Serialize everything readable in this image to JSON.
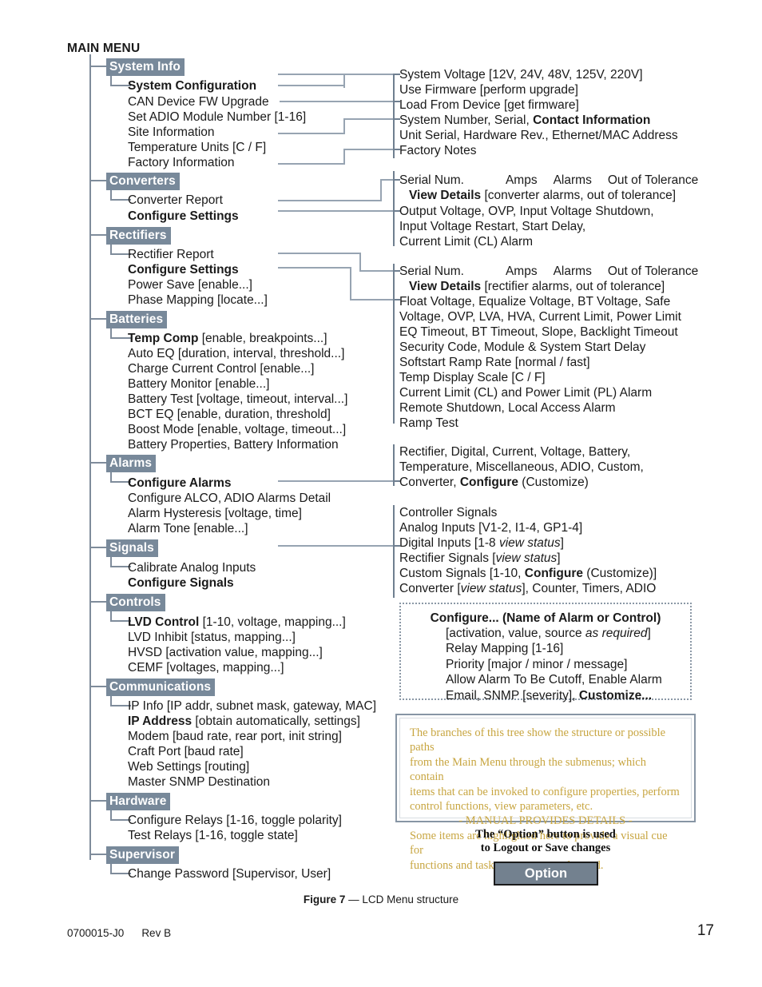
{
  "page": {
    "title": "MAIN MENU",
    "figure_caption_strong": "Figure 7",
    "figure_caption_dash": "—",
    "figure_caption_text": "LCD Menu structure",
    "footer_doc": "0700015-J0",
    "footer_rev": "Rev B",
    "page_number": "17",
    "accent_badge_color": "#78899a",
    "accent_line_color": "#97a4b2",
    "note_text_color": "#c8a642",
    "option_button_color": "#73818f"
  },
  "menu": [
    {
      "key": "system-info",
      "badge": "System Info",
      "items": [
        {
          "label": "System Configuration",
          "bold": true
        },
        {
          "label": "CAN Device FW Upgrade",
          "bold": false
        },
        {
          "label": "Set ADIO Module Number [1-16]",
          "bold": false
        },
        {
          "label": "Site Information",
          "bold": false
        },
        {
          "label": "Temperature Units [C / F]",
          "bold": false
        },
        {
          "label": "Factory Information",
          "bold": false
        }
      ]
    },
    {
      "key": "converters",
      "badge": "Converters",
      "items": [
        {
          "label": "Converter Report",
          "bold": false
        },
        {
          "label": "Configure Settings",
          "bold": true
        }
      ]
    },
    {
      "key": "rectifiers",
      "badge": "Rectifiers",
      "items": [
        {
          "label": "Rectifier Report",
          "bold": false
        },
        {
          "label": "Configure Settings",
          "bold": true
        },
        {
          "label": "Power Save [enable...]",
          "bold": false
        },
        {
          "label": "Phase Mapping [locate...]",
          "bold": false
        }
      ]
    },
    {
      "key": "batteries",
      "badge": "Batteries",
      "items": [
        {
          "label": "Temp Comp [enable, breakpoints...]",
          "bold": false,
          "bold_prefix": "Temp Comp"
        },
        {
          "label": "Auto EQ [duration, interval, threshold...]",
          "bold": false
        },
        {
          "label": "Charge Current Control [enable...]",
          "bold": false
        },
        {
          "label": "Battery Monitor [enable...]",
          "bold": false
        },
        {
          "label": "Battery Test [voltage, timeout, interval...]",
          "bold": false
        },
        {
          "label": "BCT EQ [enable, duration, threshold]",
          "bold": false
        },
        {
          "label": "Boost Mode [enable, voltage, timeout...]",
          "bold": false
        },
        {
          "label": "Battery Properties, Battery Information",
          "bold": false
        }
      ]
    },
    {
      "key": "alarms",
      "badge": "Alarms",
      "items": [
        {
          "label": "Configure Alarms",
          "bold": true
        },
        {
          "label": "Configure ALCO, ADIO Alarms Detail",
          "bold": false
        },
        {
          "label": "Alarm Hysteresis [voltage, time]",
          "bold": false
        },
        {
          "label": "Alarm Tone [enable...]",
          "bold": false
        }
      ]
    },
    {
      "key": "signals",
      "badge": "Signals",
      "items": [
        {
          "label": "Calibrate Analog Inputs",
          "bold": false
        },
        {
          "label": "Configure Signals",
          "bold": true
        }
      ]
    },
    {
      "key": "controls",
      "badge": "Controls",
      "items": [
        {
          "label": "LVD Control [1-10, voltage, mapping...]",
          "bold": false,
          "bold_prefix": "LVD Control"
        },
        {
          "label": "LVD Inhibit [status, mapping...]",
          "bold": false
        },
        {
          "label": "HVSD [activation value, mapping...]",
          "bold": false
        },
        {
          "label": "CEMF [voltages, mapping...]",
          "bold": false
        }
      ]
    },
    {
      "key": "communications",
      "badge": "Communications",
      "items": [
        {
          "label": "IP Info [IP addr, subnet mask, gateway, MAC]",
          "bold": false
        },
        {
          "label": "IP Address [obtain automatically, settings]",
          "bold": false,
          "bold_prefix": "IP Address"
        },
        {
          "label": "Modem [baud rate, rear port, init string]",
          "bold": false
        },
        {
          "label": "Craft Port [baud rate]",
          "bold": false
        },
        {
          "label": "Web Settings [routing]",
          "bold": false
        },
        {
          "label": "Master SNMP Destination",
          "bold": false
        }
      ]
    },
    {
      "key": "hardware",
      "badge": "Hardware",
      "items": [
        {
          "label": "Configure Relays [1-16, toggle polarity]",
          "bold": false
        },
        {
          "label": "Test Relays [1-16, toggle state]",
          "bold": false
        }
      ]
    },
    {
      "key": "supervisor",
      "badge": "Supervisor",
      "items": [
        {
          "label": "Change Password [Supervisor, User]",
          "bold": false
        }
      ]
    }
  ],
  "details": {
    "system_info": [
      "System Voltage [12V, 24V, 48V, 125V, 220V]",
      "Use Firmware [perform upgrade]",
      "Load From Device [get firmware]",
      "System Number, Serial, Contact Information",
      "Unit Serial, Hardware Rev., Ethernet/MAC Address",
      "Factory Notes"
    ],
    "converters": [
      "Serial Num.         Amps    Alarms    Out of Tolerance",
      "View Details [converter alarms, out of tolerance]",
      "Output Voltage, OVP, Input Voltage Shutdown,",
      "Input Voltage Restart, Start Delay,",
      "Current Limit (CL) Alarm"
    ],
    "rectifiers": [
      "Serial Num.         Amps    Alarms    Out of Tolerance",
      "View Details [rectifier alarms, out of tolerance]",
      "Float Voltage, Equalize Voltage, BT Voltage, Safe",
      "Voltage, OVP, LVA, HVA, Current Limit, Power Limit",
      "EQ Timeout, BT Timeout, Slope, Backlight Timeout",
      "Security Code, Module & System Start Delay",
      "Softstart Ramp Rate [normal / fast]",
      "Temp Display Scale [C / F]",
      "Current Limit (CL) and Power Limit (PL) Alarm",
      "Remote Shutdown, Local Access Alarm",
      "Ramp Test"
    ],
    "alarms": [
      "Rectifier, Digital, Current, Voltage, Battery,",
      "Temperature, Miscellaneous, ADIO, Custom,",
      "Converter, Configure (Customize)"
    ],
    "signals": [
      "Controller Signals",
      "Analog Inputs [V1-2, I1-4, GP1-4]",
      "Digital Inputs [1-8 view status]",
      "Rectifier Signals [view status]",
      "Custom Signals [1-10, Configure (Customize)]",
      "Converter [view status], Counter, Timers, ADIO"
    ]
  },
  "configure_box": {
    "title": "Configure... (Name of Alarm or Control)",
    "lines": [
      "[activation, value, source as required]",
      "Relay Mapping [1-16]",
      "Priority [major / minor / message]",
      "Allow Alarm To Be Cutoff, Enable Alarm",
      "Email, SNMP [severity], Customize..."
    ]
  },
  "note_box": {
    "line1": "The branches of this tree show the structure or possible paths",
    "line2": "from the Main Menu through the submenus; which contain",
    "line3": "items that can be invoked to configure properties, perform",
    "line4": "control functions, view parameters, etc.",
    "line5": "- MANUAL PROVIDES DETAILS -",
    "line6": "Some items are highlighted here to provide a visual cue for",
    "line7": "functions and tasks most commonly used."
  },
  "option": {
    "caption_line1": "The “Option” button is used",
    "caption_line2": "to Logout or Save changes",
    "button_label": "Option"
  }
}
